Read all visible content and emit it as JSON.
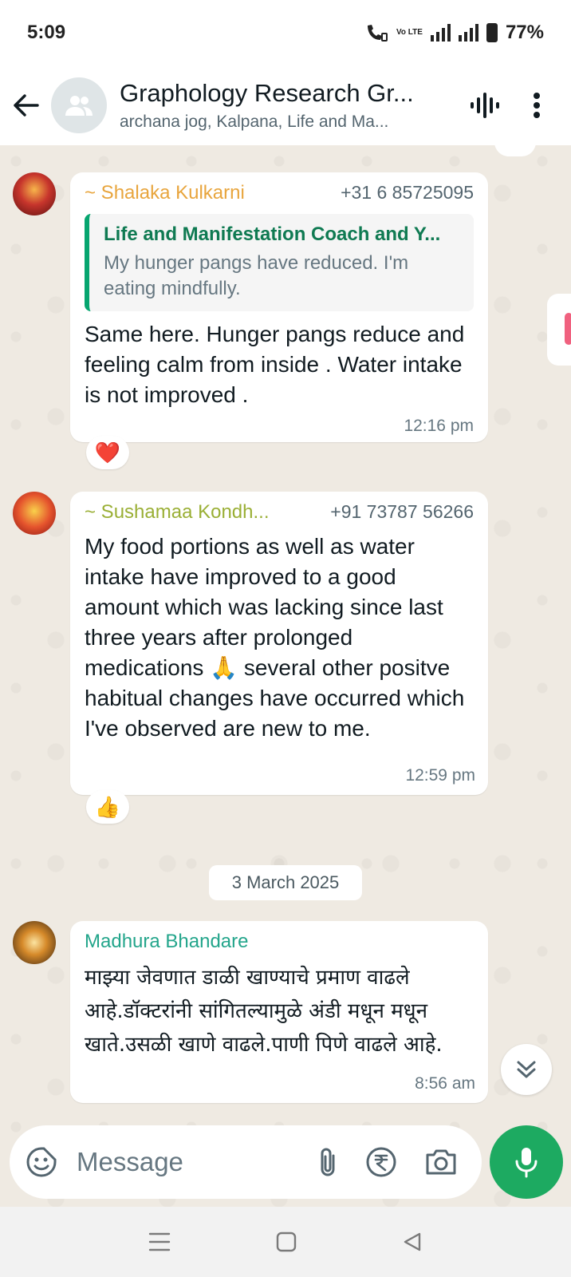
{
  "status_bar": {
    "time": "5:09",
    "network": "Vo LTE",
    "battery": "77%"
  },
  "header": {
    "title": "Graphology Research Gr...",
    "members": "archana jog, Kalpana, Life and Ma..."
  },
  "messages": [
    {
      "sender": "~ Shalaka Kulkarni",
      "phone": "+31 6 85725095",
      "quote_author": "Life and Manifestation Coach and Y...",
      "quote_text": "My hunger pangs have reduced. I'm eating mindfully.",
      "text": "Same here. Hunger pangs reduce and feeling calm from inside . Water intake is not improved .",
      "time": "12:16 pm",
      "reaction": "❤️"
    },
    {
      "sender": "~ Sushamaa Kondh...",
      "phone": "+91 73787 56266",
      "text": "My food portions as well as water intake have improved to a good amount which was lacking since last three years after prolonged medications 🙏 several other positve habitual changes have occurred which I've observed are new to me.",
      "time": "12:59 pm",
      "reaction": "👍"
    },
    {
      "sender": "Madhura Bhandare",
      "text": "माझ्या जेवणात डाळी खाण्याचे प्रमाण वाढले आहे.डॉक्टरांनी सांगितल्यामुळे अंडी मधून मधून खाते.उसळी खाणे वाढले.पाणी पिणे वाढले आहे.",
      "time": "8:56 am"
    }
  ],
  "date_separator": "3 March 2025",
  "composer": {
    "placeholder": "Message"
  },
  "colors": {
    "accent": "#1daa61",
    "chat_bg": "#efeae2",
    "quote_bar": "#06a56f"
  }
}
